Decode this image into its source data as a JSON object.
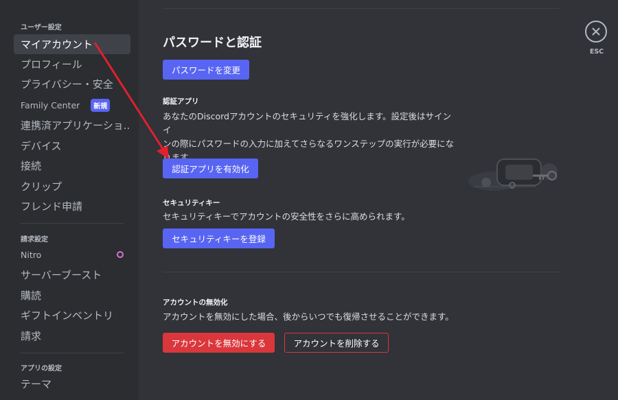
{
  "sidebar": {
    "section_user": "ユーザー設定",
    "items_user": [
      {
        "label": "マイアカウント",
        "active": true
      },
      {
        "label": "プロフィール"
      },
      {
        "label": "プライバシー・安全"
      },
      {
        "label": "Family Center",
        "badge": "新規"
      },
      {
        "label": "連携済アプリケーショ..."
      },
      {
        "label": "デバイス"
      },
      {
        "label": "接続"
      },
      {
        "label": "クリップ"
      },
      {
        "label": "フレンド申請"
      }
    ],
    "section_billing": "請求設定",
    "items_billing": [
      {
        "label": "Nitro"
      },
      {
        "label": "サーバーブースト"
      },
      {
        "label": "購読"
      },
      {
        "label": "ギフトインベントリ"
      },
      {
        "label": "請求"
      }
    ],
    "section_app": "アプリの設定",
    "items_app": [
      {
        "label": "テーマ"
      }
    ]
  },
  "main": {
    "title": "パスワードと認証",
    "change_password_label": "パスワードを変更",
    "auth_app": {
      "label": "認証アプリ",
      "desc_line1": "あなたのDiscordアカウントのセキュリティを強化します。設定後はサインイ",
      "desc_line2": "ンの際にパスワードの入力に加えてさらなるワンステップの実行が必要にな",
      "desc_line3": "ります。",
      "button_label": "認証アプリを有効化"
    },
    "security_key": {
      "label": "セキュリティキー",
      "desc": "セキュリティキーでアカウントの安全性をさらに高められます。",
      "button_label": "セキュリティキーを登録"
    },
    "disable_account": {
      "label": "アカウントの無効化",
      "desc": "アカウントを無効にした場合、後からいつでも復帰させることができます。",
      "disable_label": "アカウントを無効にする",
      "delete_label": "アカウントを削除する"
    }
  },
  "close": {
    "esc_label": "ESC"
  },
  "colors": {
    "accent": "#5865f2",
    "danger": "#da373c",
    "annotation_arrow": "#e02030"
  },
  "icons": [
    "close-icon",
    "nitro-icon",
    "security-illustration"
  ]
}
